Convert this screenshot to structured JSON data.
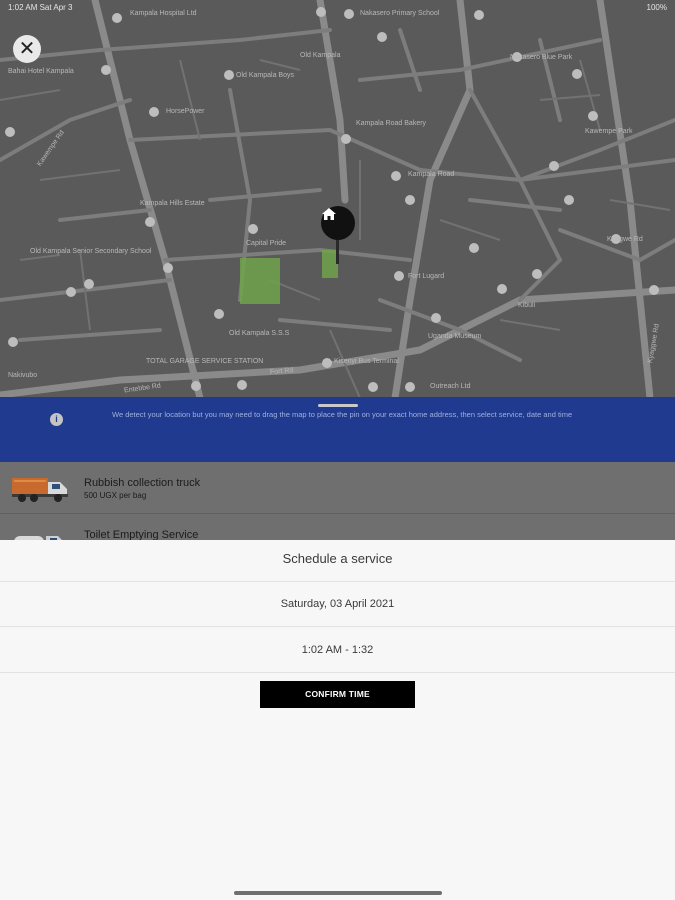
{
  "status_bar": {
    "time_date": "1:02 AM   Sat Apr 3",
    "battery": "100%"
  },
  "map": {
    "labels": [
      "Kampala Hospital Ltd",
      "Nakasero Primary School",
      "Old Kampala Boys",
      "Kawempe Rd",
      "Bahai Hotel Kampala",
      "HorsePower",
      "Old Kampala",
      "Nakasero Blue Park",
      "Kampala Hills Estate",
      "Kawempe Park",
      "Old Kampala Senior Secondary School",
      "Capital Pride",
      "Kampala Road",
      "Kyagwe Rd",
      "Fort Lugard",
      "Uganda Museum",
      "Old Kampala S.S.S",
      "Kisenyi Bus Terminal",
      "Entebbe Rd",
      "Fort Rd",
      "TOTAL GARAGE SERVICE STATION",
      "Outreach Ltd",
      "Kampala Road Bakery",
      "Kibuli",
      "Nakivubo",
      "Kyaggwe Rd"
    ]
  },
  "banner": {
    "text": "We detect your location but you may need to drag the map to place the pin on your exact home address, then select service, date and time"
  },
  "services": [
    {
      "title": "Rubbish collection truck",
      "subtitle": "500 UGX per bag"
    },
    {
      "title": "Toilet Emptying Service",
      "subtitle": ""
    }
  ],
  "sheet": {
    "title": "Schedule a service",
    "date": "Saturday, 03 April 2021",
    "time": "1:02 AM - 1:32",
    "confirm_label": "CONFIRM TIME"
  },
  "icons": {
    "close": "close-icon",
    "home": "home-icon",
    "info": "info-icon",
    "truck": "garbage-truck-icon",
    "pin": "map-pin-icon"
  },
  "colors": {
    "banner": "#203a8f",
    "confirm_button": "#000000",
    "map_overlay": "#5a5a5a",
    "park_green": "#6fa34a"
  }
}
